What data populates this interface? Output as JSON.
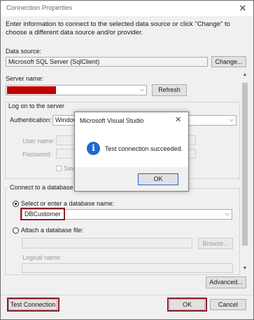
{
  "window": {
    "title": "Connection Properties",
    "close_glyph": "✕",
    "intro": "Enter information to connect to the selected data source or click \"Change\" to choose a different data source and/or provider."
  },
  "data_source": {
    "label": "Data source:",
    "value": "Microsoft SQL Server (SqlClient)",
    "change_button": "Change..."
  },
  "server": {
    "label": "Server name:",
    "value": "",
    "refresh_button": "Refresh"
  },
  "logon": {
    "group_label": "Log on to the server",
    "auth_label": "Authentication:",
    "auth_value": "Windows Authentication",
    "user_label": "User name:",
    "password_label": "Password:",
    "save_password": "Save my password"
  },
  "database": {
    "group_label": "Connect to a database",
    "select_option": "Select or enter a database name:",
    "db_value": "DBCustomer",
    "attach_option": "Attach a database file:",
    "browse_button": "Browse...",
    "logical_label": "Logical name:"
  },
  "footer": {
    "advanced_button": "Advanced...",
    "test_button": "Test Connection",
    "ok_button": "OK",
    "cancel_button": "Cancel"
  },
  "dialog": {
    "title": "Microsoft Visual Studio",
    "close_glyph": "✕",
    "message": "Test connection succeeded.",
    "ok_button": "OK",
    "icon_glyph": "i"
  },
  "colors": {
    "highlight_border": "#8b1e2a",
    "redacted": "#c00000",
    "info_icon": "#1f6ad0"
  }
}
